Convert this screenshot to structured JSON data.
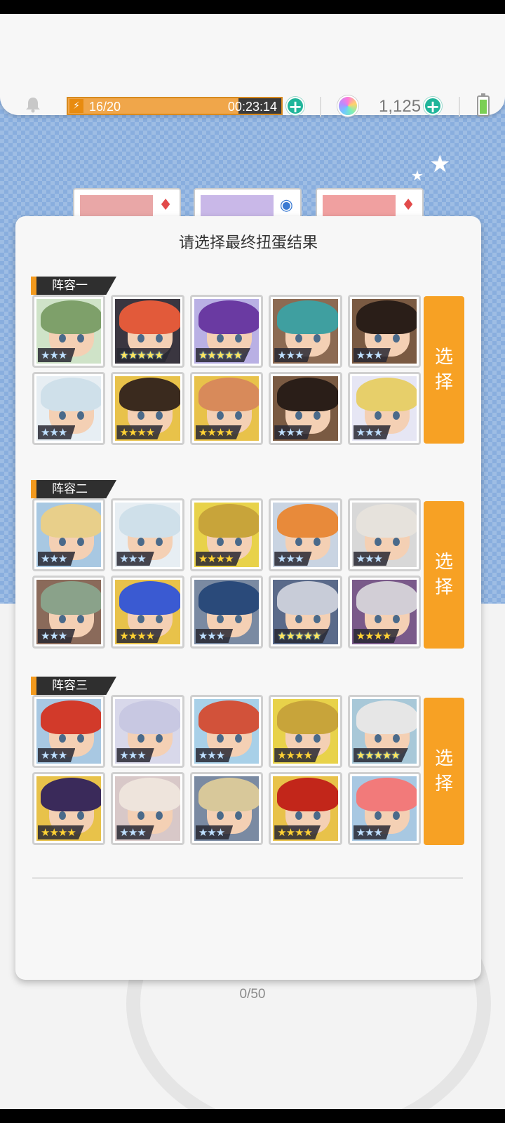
{
  "topbar": {
    "energy_text": "16/20",
    "energy_fraction": 0.8,
    "energy_timer": "00:23:14",
    "gem_count": "1,125",
    "colors": {
      "energy": "#f0a64a",
      "plus": "#20b59a"
    }
  },
  "modal": {
    "title": "请选择最终扭蛋结果",
    "select_label_1": "选",
    "select_label_2": "择",
    "teams": [
      {
        "label": "阵容一",
        "heroes": [
          {
            "stars": "★★★",
            "tier": 3,
            "hair": "#7ea06a",
            "bg": "#cfe3c8"
          },
          {
            "stars": "★★★★★",
            "tier": 5,
            "hair": "#e25a3a",
            "bg": "#3a3640"
          },
          {
            "stars": "★★★★★",
            "tier": 5,
            "hair": "#6a3aa2",
            "bg": "#b9b0e4"
          },
          {
            "stars": "★★★",
            "tier": 3,
            "hair": "#3f9fa0",
            "bg": "#8c6a52"
          },
          {
            "stars": "★★★",
            "tier": 3,
            "hair": "#2a1e18",
            "bg": "#7a5a42"
          },
          {
            "stars": "★★★",
            "tier": 3,
            "hair": "#cfe0ea",
            "bg": "#e7eef3"
          },
          {
            "stars": "★★★★",
            "tier": 4,
            "hair": "#3a2a1e",
            "bg": "#e8c24a"
          },
          {
            "stars": "★★★★",
            "tier": 4,
            "hair": "#d88a5a",
            "bg": "#e8c24a"
          },
          {
            "stars": "★★★",
            "tier": 3,
            "hair": "#2a1e18",
            "bg": "#7a5a42"
          },
          {
            "stars": "★★★",
            "tier": 3,
            "hair": "#e7cf6a",
            "bg": "#e6e6f4"
          }
        ]
      },
      {
        "label": "阵容二",
        "heroes": [
          {
            "stars": "★★★",
            "tier": 3,
            "hair": "#e8cf8a",
            "bg": "#a8c8e2"
          },
          {
            "stars": "★★★",
            "tier": 3,
            "hair": "#cfe0ea",
            "bg": "#e7eef3"
          },
          {
            "stars": "★★★★",
            "tier": 4,
            "hair": "#c8a43a",
            "bg": "#e8d24a"
          },
          {
            "stars": "★★★",
            "tier": 3,
            "hair": "#e88a3a",
            "bg": "#c9d4e2"
          },
          {
            "stars": "★★★",
            "tier": 3,
            "hair": "#e6e2dc",
            "bg": "#d8d8d8"
          },
          {
            "stars": "★★★",
            "tier": 3,
            "hair": "#8aa28a",
            "bg": "#8a6a5a"
          },
          {
            "stars": "★★★★",
            "tier": 4,
            "hair": "#3a5ad2",
            "bg": "#e8c24a"
          },
          {
            "stars": "★★★",
            "tier": 3,
            "hair": "#2a4a7a",
            "bg": "#7a8aa2"
          },
          {
            "stars": "★★★★★",
            "tier": 5,
            "hair": "#c8ccd8",
            "bg": "#5a6a8a"
          },
          {
            "stars": "★★★★",
            "tier": 4,
            "hair": "#d2ced6",
            "bg": "#7a5a8a"
          }
        ]
      },
      {
        "label": "阵容三",
        "heroes": [
          {
            "stars": "★★★",
            "tier": 3,
            "hair": "#d23a2a",
            "bg": "#a8c8e2"
          },
          {
            "stars": "★★★",
            "tier": 3,
            "hair": "#c8c8e2",
            "bg": "#d8d8ea"
          },
          {
            "stars": "★★★",
            "tier": 3,
            "hair": "#d2523a",
            "bg": "#a8d0e8"
          },
          {
            "stars": "★★★★",
            "tier": 4,
            "hair": "#c8a43a",
            "bg": "#e8d24a"
          },
          {
            "stars": "★★★★★",
            "tier": 5,
            "hair": "#e6e6e6",
            "bg": "#a8c8d8"
          },
          {
            "stars": "★★★★",
            "tier": 4,
            "hair": "#3a2a5a",
            "bg": "#e8c24a"
          },
          {
            "stars": "★★★",
            "tier": 3,
            "hair": "#eee4dc",
            "bg": "#d8c8c8"
          },
          {
            "stars": "★★★",
            "tier": 3,
            "hair": "#d8c89a",
            "bg": "#7a8aa2"
          },
          {
            "stars": "★★★★",
            "tier": 4,
            "hair": "#c2261a",
            "bg": "#e8c24a"
          },
          {
            "stars": "★★★",
            "tier": 3,
            "hair": "#f27a7a",
            "bg": "#a8c8e2"
          }
        ]
      }
    ]
  },
  "bottom": {
    "progress": "0/50"
  }
}
